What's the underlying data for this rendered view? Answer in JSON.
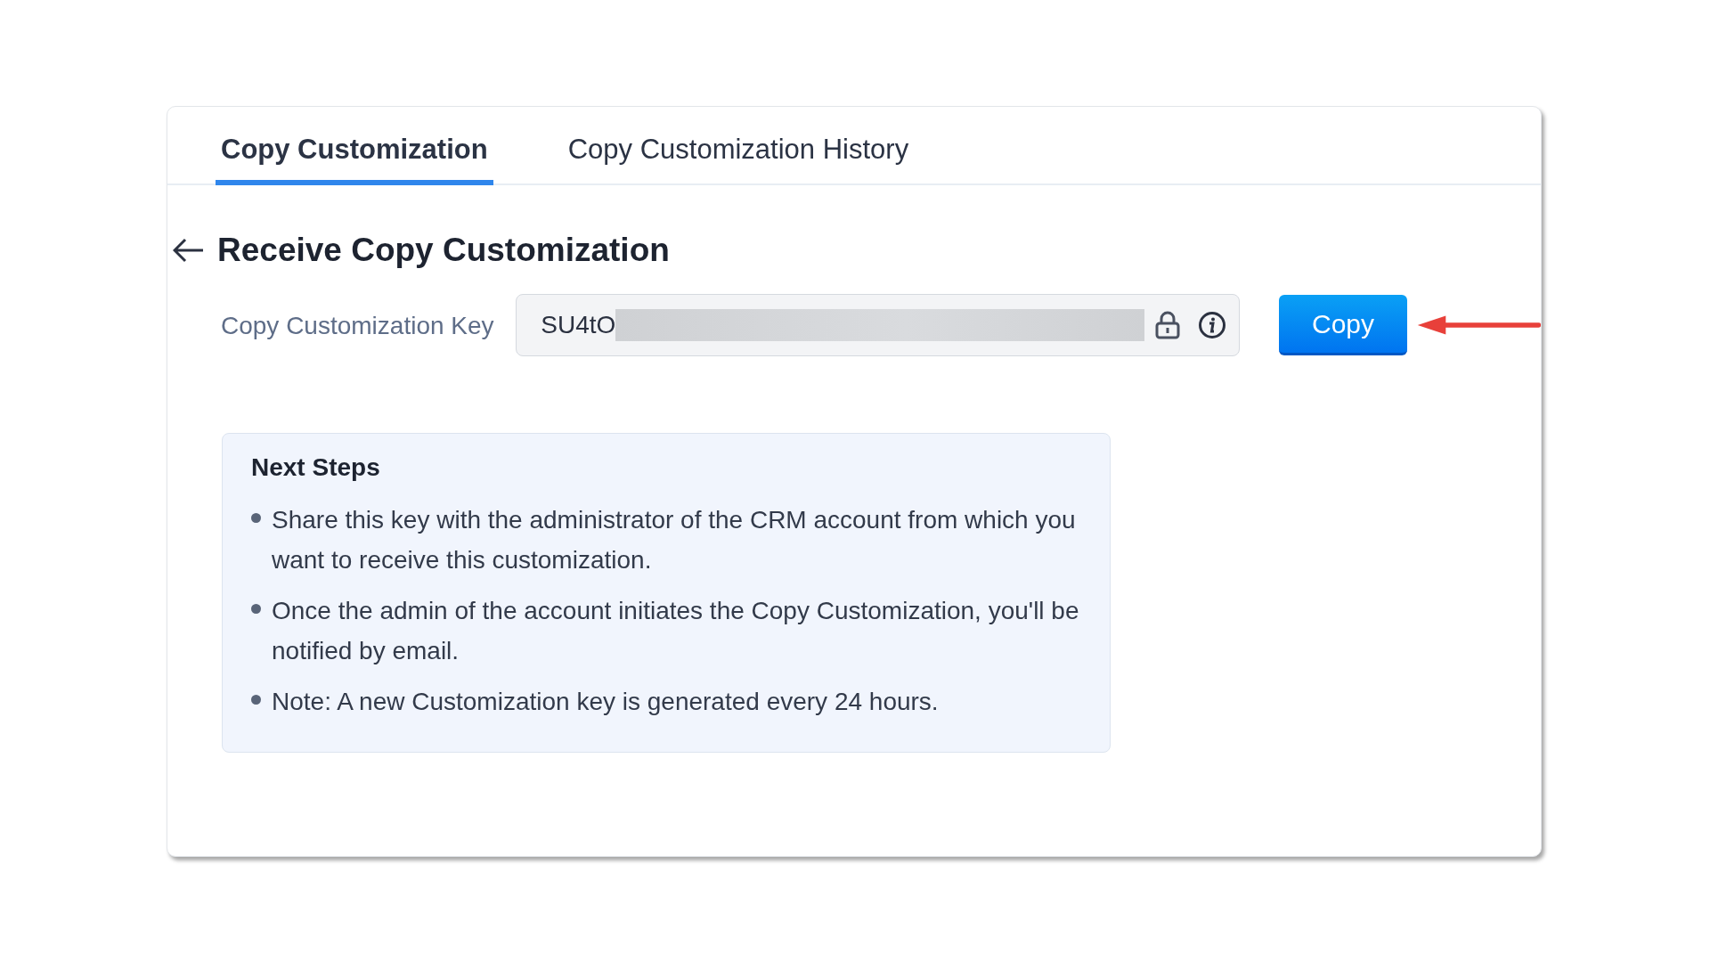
{
  "tabs": [
    {
      "label": "Copy Customization",
      "selected": true
    },
    {
      "label": "Copy Customization History",
      "selected": false
    }
  ],
  "heading": "Receive Copy Customization",
  "key_field": {
    "label": "Copy Customization Key",
    "value": "SU4tO",
    "redacted": true
  },
  "copy_button": "Copy",
  "next_steps": {
    "title": "Next Steps",
    "items": [
      "Share this key with the administrator of the CRM account from which you want to receive this customization.",
      "Once the admin of the account initiates the Copy Customization, you'll be notified by email.",
      "Note: A new Customization key is generated every 24 hours."
    ]
  }
}
